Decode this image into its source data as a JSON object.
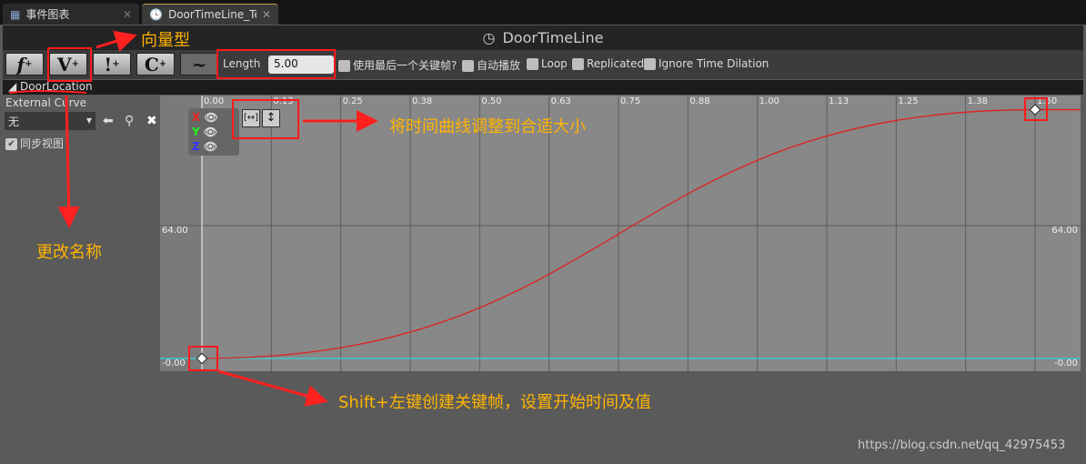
{
  "tabs": [
    {
      "label": "事件图表",
      "icon": "event-graph-icon"
    },
    {
      "label": "DoorTimeLine_Tem",
      "icon": "clock-icon"
    }
  ],
  "title": {
    "label": "DoorTimeLine",
    "icon": "clock-icon"
  },
  "toolbar": {
    "buttons": [
      {
        "label": "f",
        "name": "add-float-track"
      },
      {
        "label": "V",
        "name": "add-vector-track"
      },
      {
        "label": "!",
        "name": "add-event-track"
      },
      {
        "label": "C",
        "name": "add-color-track"
      },
      {
        "label": "~",
        "name": "add-curve-asset"
      }
    ],
    "length_label": "Length",
    "length_value": "5.00",
    "options": [
      "使用最后一个关键帧?",
      "自动播放",
      "Loop",
      "Replicated",
      "Ignore Time Dilation"
    ]
  },
  "track": {
    "name": "DoorLocation",
    "external_curve_label": "External Curve",
    "external_curve_value": "无",
    "sync_view": "同步视图",
    "axes": [
      "X",
      "Y",
      "Z"
    ]
  },
  "graph": {
    "time_ticks": [
      "0.00",
      "0.13",
      "0.25",
      "0.38",
      "0.50",
      "0.63",
      "0.75",
      "0.88",
      "1.00",
      "1.13",
      "1.25",
      "1.38",
      "1.50"
    ],
    "value_labels": {
      "mid": "64.00",
      "bottom": "-0.00"
    },
    "keys": [
      [
        0,
        0
      ],
      [
        1.5,
        125
      ]
    ],
    "curve_color": "#e02020",
    "flat_color": "#3fc7c7"
  },
  "annotations": {
    "vector": "向量型",
    "fit": "将时间曲线调整到合适大小",
    "rename": "更改名称",
    "key": "Shift+左键创建关键帧，设置开始时间及值"
  },
  "watermark": "https://blog.csdn.net/qq_42975453"
}
